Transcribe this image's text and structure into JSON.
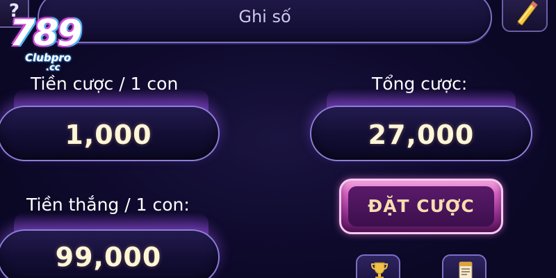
{
  "header": {
    "help_symbol": "?",
    "title": "Ghi số",
    "edit_icon": "pencil-icon"
  },
  "logo": {
    "number": "789",
    "club": "Clubpro",
    "domain": ".cc"
  },
  "bet": {
    "per_unit_label": "Tiền cược / 1 con",
    "per_unit_value": "1,000",
    "total_label": "Tổng cược:",
    "total_value": "27,000",
    "win_label": "Tiền thắng / 1 con:",
    "win_value": "99,000",
    "place_button": "ĐẶT CƯỢC"
  },
  "footer_icons": [
    "trophy-icon",
    "document-icon"
  ],
  "colors": {
    "background": "#0e0a2b",
    "pill_border": "#8c7fd8",
    "value_text": "#fff6d8",
    "bet_button": "#d764c3",
    "bet_text": "#f7ddb0"
  }
}
